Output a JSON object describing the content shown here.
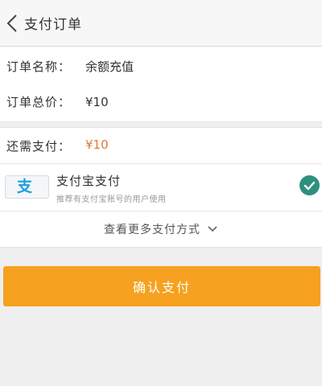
{
  "header": {
    "title": "支付订单",
    "back_icon": "chevron-left-icon"
  },
  "order": {
    "name_label": "订单名称：",
    "name_value": "余额充值",
    "total_label": "订单总价：",
    "total_value": "¥10"
  },
  "payment": {
    "due_label": "还需支付：",
    "due_value": "¥10",
    "due_color": "#e07a2f",
    "method": {
      "logo_glyph": "支",
      "logo_icon": "alipay-icon",
      "title": "支付宝支付",
      "description": "推荐有支付宝账号的用户使用",
      "selected": true,
      "check_color": "#2e8f7f"
    },
    "more_label": "查看更多支付方式",
    "more_icon": "chevron-down-icon"
  },
  "confirm": {
    "label": "确认支付",
    "color": "#f6a11f"
  }
}
